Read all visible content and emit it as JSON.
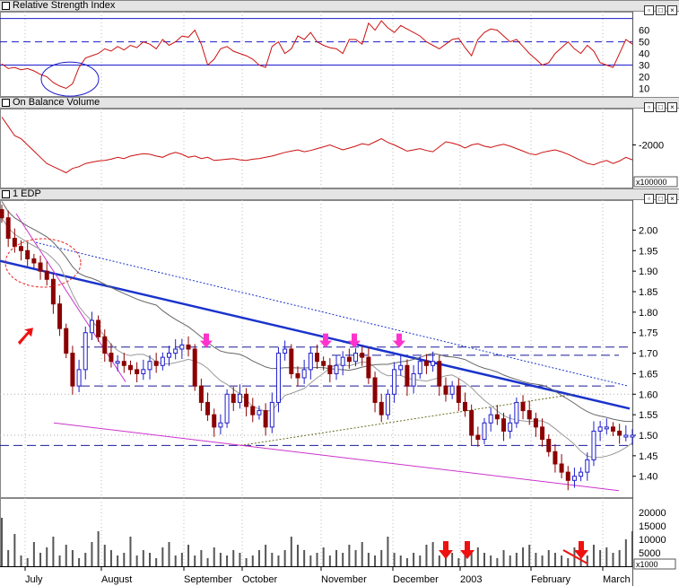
{
  "panes": {
    "rsi": {
      "title": "Relative Strength Index",
      "scale": [
        "60",
        "50",
        "40",
        "30",
        "20",
        "10"
      ]
    },
    "obv": {
      "title": "On Balance Volume",
      "scale": [
        "-2000"
      ],
      "multiplier": "x100000"
    },
    "price": {
      "title": "1 EDP",
      "scale": [
        "2.00",
        "1.95",
        "1.90",
        "1.85",
        "1.80",
        "1.75",
        "1.70",
        "1.65",
        "1.60",
        "1.55",
        "1.50",
        "1.45",
        "1.40"
      ]
    },
    "volume": {
      "scale": [
        "20000",
        "15000",
        "10000",
        "5000"
      ],
      "multiplier": "x1000"
    }
  },
  "buttons": {
    "restore": "▫",
    "max": "□",
    "close": "×"
  },
  "xaxis": [
    "July",
    "August",
    "September",
    "October",
    "November",
    "December",
    "2003",
    "February",
    "March"
  ],
  "colors": {
    "candle_down": "#8b0000",
    "candle_up": "#1e1ecc",
    "trendline": "#1a33cc",
    "support": "#cc33cc",
    "indicator": "#cc1111",
    "arrow": "#ee1111",
    "marker": "#ff33cc"
  },
  "chart_data": [
    {
      "type": "line",
      "title": "Relative Strength Index",
      "ylim": [
        5,
        72
      ],
      "reference_lines": [
        70,
        50,
        30
      ],
      "series": [
        {
          "name": "Relative Strength Index",
          "values": [
            31,
            27,
            28,
            26,
            27,
            25,
            22,
            20,
            15,
            12,
            10,
            14,
            28,
            36,
            38,
            40,
            44,
            42,
            46,
            43,
            47,
            45,
            50,
            48,
            44,
            52,
            47,
            50,
            55,
            54,
            60,
            48,
            30,
            35,
            44,
            46,
            42,
            40,
            38,
            35,
            30,
            28,
            46,
            50,
            40,
            44,
            55,
            52,
            58,
            50,
            47,
            45,
            44,
            40,
            52,
            52,
            48,
            66,
            60,
            68,
            62,
            58,
            64,
            61,
            58,
            55,
            50,
            47,
            44,
            48,
            52,
            53,
            45,
            38,
            52,
            58,
            61,
            60,
            55,
            50,
            52,
            46,
            40,
            35,
            30,
            32,
            40,
            45,
            50,
            44,
            40,
            47,
            42,
            32,
            30,
            28,
            40,
            52,
            48
          ]
        }
      ]
    },
    {
      "type": "line",
      "title": "On Balance Volume",
      "series": [
        {
          "name": "On Balance Volume",
          "values": [
            -1550,
            -1700,
            -1850,
            -1900,
            -2000,
            -2100,
            -2200,
            -2300,
            -2350,
            -2400,
            -2450,
            -2380,
            -2350,
            -2300,
            -2280,
            -2260,
            -2250,
            -2230,
            -2200,
            -2220,
            -2180,
            -2160,
            -2140,
            -2150,
            -2180,
            -2200,
            -2150,
            -2120,
            -2150,
            -2200,
            -2180,
            -2220,
            -2200,
            -2250,
            -2240,
            -2230,
            -2220,
            -2240,
            -2250,
            -2230,
            -2220,
            -2200,
            -2180,
            -2150,
            -2120,
            -2100,
            -2080,
            -2110,
            -2090,
            -2060,
            -2030,
            -2000,
            -2040,
            -2080,
            -2050,
            -2020,
            -1980,
            -2000,
            -1950,
            -1900,
            -1960,
            -2000,
            -2050,
            -2100,
            -2080,
            -2060,
            -2090,
            -2110,
            -2030,
            -1950,
            -1970,
            -2000,
            -2050,
            -2000,
            -1980,
            -2020,
            -2040,
            -2010,
            -1990,
            -2020,
            -2060,
            -2100,
            -2140,
            -2160,
            -2120,
            -2100,
            -2080,
            -2110,
            -2150,
            -2200,
            -2250,
            -2300,
            -2320,
            -2280,
            -2250,
            -2300,
            -2260,
            -2200,
            -2240
          ]
        }
      ]
    },
    {
      "type": "line",
      "title": "1 EDP",
      "ylim": [
        1.36,
        2.06
      ],
      "series": [
        {
          "name": "1 EDP",
          "values": [
            2.03,
            1.98,
            1.96,
            1.95,
            1.93,
            1.92,
            1.9,
            1.88,
            1.82,
            1.76,
            1.7,
            1.62,
            1.66,
            1.75,
            1.78,
            1.74,
            1.7,
            1.68,
            1.68,
            1.67,
            1.66,
            1.65,
            1.66,
            1.68,
            1.67,
            1.69,
            1.7,
            1.71,
            1.72,
            1.71,
            1.62,
            1.58,
            1.55,
            1.52,
            1.53,
            1.6,
            1.58,
            1.6,
            1.57,
            1.55,
            1.56,
            1.52,
            1.58,
            1.7,
            1.71,
            1.65,
            1.64,
            1.66,
            1.7,
            1.68,
            1.67,
            1.65,
            1.67,
            1.69,
            1.68,
            1.7,
            1.69,
            1.64,
            1.58,
            1.55,
            1.6,
            1.66,
            1.67,
            1.62,
            1.65,
            1.68,
            1.67,
            1.68,
            1.62,
            1.6,
            1.62,
            1.58,
            1.56,
            1.5,
            1.49,
            1.53,
            1.55,
            1.54,
            1.51,
            1.53,
            1.58,
            1.56,
            1.54,
            1.52,
            1.49,
            1.46,
            1.43,
            1.41,
            1.39,
            1.4,
            1.41,
            1.44,
            1.51,
            1.52,
            1.52,
            1.51,
            1.5,
            1.5,
            1.5
          ]
        }
      ]
    },
    {
      "type": "bar",
      "title": "Volume",
      "values": [
        18000,
        6000,
        12000,
        4000,
        3000,
        9000,
        5000,
        7000,
        11000,
        4000,
        8000,
        6000,
        3000,
        5000,
        9000,
        13000,
        8000,
        6000,
        4000,
        5000,
        11000,
        4000,
        6000,
        5000,
        3000,
        7000,
        9000,
        4000,
        5000,
        8000,
        4000,
        6000,
        3000,
        7000,
        5000,
        4000,
        6000,
        5000,
        3000,
        4000,
        6000,
        8000,
        5000,
        4000,
        6000,
        11000,
        8000,
        6000,
        4000,
        5000,
        7000,
        4000,
        6000,
        5000,
        8000,
        6000,
        9000,
        5000,
        4000,
        6000,
        11000,
        5000,
        4000,
        3000,
        5000,
        4000,
        8000,
        9000,
        4000,
        6000,
        5000,
        3000,
        4000,
        6000,
        7000,
        5000,
        4000,
        3000,
        6000,
        4000,
        5000,
        7000,
        8000,
        5000,
        4000,
        6000,
        5000,
        4000,
        3000,
        7000,
        5000,
        4000,
        8000,
        6000,
        7000,
        5000,
        6000,
        10000,
        13000
      ]
    }
  ]
}
